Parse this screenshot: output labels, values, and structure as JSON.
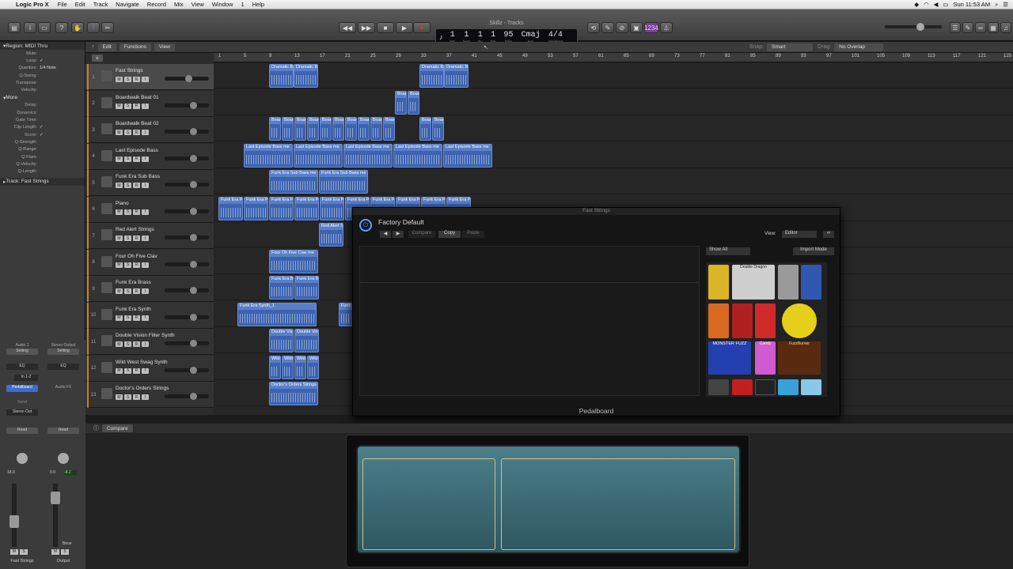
{
  "menubar": {
    "app": "Logic Pro X",
    "items": [
      "File",
      "Edit",
      "Track",
      "Navigate",
      "Record",
      "Mix",
      "View",
      "Window",
      "1",
      "Help"
    ],
    "clock": "Sun 11:53 AM"
  },
  "window_title": "Skillz - Tracks",
  "lcd": {
    "bar": "1",
    "beat": "1",
    "div": "1",
    "tick": "1",
    "tempo": "95",
    "key": "Cmaj",
    "sig": "4/4",
    "labels": [
      "bar",
      "beat",
      "div",
      "tick",
      "bpm",
      "key",
      "signature"
    ]
  },
  "count_in": "1234",
  "toolbar_right": {
    "snap_label": "Snap:",
    "snap_value": "Smart",
    "drag_label": "Drag:",
    "drag_value": "No Overlap"
  },
  "tracks_header": {
    "edit": "Edit",
    "functions": "Functions",
    "view": "View"
  },
  "inspector": {
    "region_title": "Region: MIDI Thru",
    "rows": [
      {
        "k": "Mute:",
        "v": ""
      },
      {
        "k": "Loop:",
        "v": "✓"
      },
      {
        "k": "Quantize:",
        "v": "1/4 Note"
      },
      {
        "k": "Q-Swing:",
        "v": ""
      },
      {
        "k": "Transpose:",
        "v": ""
      },
      {
        "k": "Velocity:",
        "v": ""
      }
    ],
    "more_title": "More",
    "more_rows": [
      {
        "k": "Delay:",
        "v": ""
      },
      {
        "k": "Dynamics:",
        "v": ""
      },
      {
        "k": "Gate Time:",
        "v": ""
      },
      {
        "k": "Clip Length:",
        "v": "✓"
      },
      {
        "k": "Score:",
        "v": "✓"
      },
      {
        "k": "Q-Strength:",
        "v": ""
      },
      {
        "k": "Q-Range:",
        "v": ""
      },
      {
        "k": "Q-Flam:",
        "v": ""
      },
      {
        "k": "Q-Velocity:",
        "v": ""
      },
      {
        "k": "Q-Length:",
        "v": ""
      }
    ],
    "track_title": "Track:  Fast Strings"
  },
  "mixer": {
    "left": {
      "input": "Audio 1",
      "setting": "Setting",
      "eq": "EQ",
      "in": "In 1-2",
      "fx": "Pedalboard",
      "send": "Send",
      "out": "Stereo Out",
      "auto": "Read",
      "vol": "18.0",
      "name": "Fast Strings",
      "ms": [
        "M",
        "S"
      ]
    },
    "right": {
      "input": "Stereo Output",
      "setting": "Setting",
      "eq": "EQ",
      "fx": "Audio FX",
      "auto": "Read",
      "vol": "0.0",
      "peak": "-8.2",
      "name": "Output",
      "bnc": "Bnce",
      "ms": [
        "M",
        "S"
      ]
    }
  },
  "ruler": [
    {
      "n": "1"
    },
    {
      "n": "5"
    },
    {
      "n": "9"
    },
    {
      "n": "13"
    },
    {
      "n": "17"
    },
    {
      "n": "21"
    },
    {
      "n": "25"
    },
    {
      "n": "29"
    },
    {
      "n": "33"
    },
    {
      "n": "37"
    },
    {
      "n": "41"
    },
    {
      "n": "45"
    },
    {
      "n": "49"
    },
    {
      "n": "53"
    },
    {
      "n": "57"
    },
    {
      "n": "61"
    },
    {
      "n": "65"
    },
    {
      "n": "69"
    },
    {
      "n": "73"
    },
    {
      "n": "77"
    },
    {
      "n": "81"
    },
    {
      "n": "85"
    },
    {
      "n": "89"
    },
    {
      "n": "93"
    },
    {
      "n": "97"
    },
    {
      "n": "101"
    },
    {
      "n": "105"
    },
    {
      "n": "109"
    },
    {
      "n": "113"
    },
    {
      "n": "117"
    },
    {
      "n": "121"
    },
    {
      "n": "125"
    }
  ],
  "tracks": [
    {
      "num": "1",
      "name": "Fast Strings",
      "sel": true
    },
    {
      "num": "2",
      "name": "Boardwalk Beat 01"
    },
    {
      "num": "3",
      "name": "Boardwalk Beat 02"
    },
    {
      "num": "4",
      "name": "Last Episode Bass"
    },
    {
      "num": "5",
      "name": "Funk Era Sub Bass"
    },
    {
      "num": "6",
      "name": "Piano"
    },
    {
      "num": "7",
      "name": "Red Alert Strings"
    },
    {
      "num": "8",
      "name": "Four Oh Five Clav"
    },
    {
      "num": "9",
      "name": "Funk Era Brass"
    },
    {
      "num": "10",
      "name": "Funk Era Synth"
    },
    {
      "num": "11",
      "name": "Double Vision Filter Synth"
    },
    {
      "num": "12",
      "name": "Wild West Swag Synth"
    },
    {
      "num": "13",
      "name": "Doctor's Orders Strings"
    }
  ],
  "track_buttons": [
    "M",
    "S",
    "R",
    "I"
  ],
  "regions": [
    {
      "lane": 0,
      "t": "Dramatic B"
    },
    {
      "lane": 0,
      "t": "Dramatic B"
    },
    {
      "lane": 0,
      "t": "Dramatic B"
    },
    {
      "lane": 0,
      "t": "Dramatic B"
    },
    {
      "lane": 1,
      "t": "Boar"
    },
    {
      "lane": 1,
      "t": "Boar"
    },
    {
      "lane": 2,
      "t": "Boar"
    },
    {
      "lane": 2,
      "t": "Boar"
    },
    {
      "lane": 2,
      "t": "Boar"
    },
    {
      "lane": 2,
      "t": "Boar"
    },
    {
      "lane": 2,
      "t": "Boar"
    },
    {
      "lane": 2,
      "t": "Boar"
    },
    {
      "lane": 2,
      "t": "Boar"
    },
    {
      "lane": 2,
      "t": "Boar"
    },
    {
      "lane": 2,
      "t": "Boar"
    },
    {
      "lane": 2,
      "t": "Boar"
    },
    {
      "lane": 2,
      "t": "Boar"
    },
    {
      "lane": 2,
      "t": "Boar"
    },
    {
      "lane": 3,
      "t": "Last Episode Bass me"
    },
    {
      "lane": 3,
      "t": "Last Episode Bass me"
    },
    {
      "lane": 3,
      "t": "Last Episode Bass me"
    },
    {
      "lane": 3,
      "t": "Last Episode Bass me"
    },
    {
      "lane": 3,
      "t": "Last Episode Bass me"
    },
    {
      "lane": 4,
      "t": "Funk Era Sub Bass me"
    },
    {
      "lane": 4,
      "t": "Funk Era Sub Bass me"
    },
    {
      "lane": 5,
      "t": "Funk Era P"
    },
    {
      "lane": 5,
      "t": "Funk Era P"
    },
    {
      "lane": 5,
      "t": "Funk Era P"
    },
    {
      "lane": 5,
      "t": "Funk Era P"
    },
    {
      "lane": 5,
      "t": "Funk Era P"
    },
    {
      "lane": 5,
      "t": "Funk Era P"
    },
    {
      "lane": 5,
      "t": "Funk Era P"
    },
    {
      "lane": 5,
      "t": "Funk Era P"
    },
    {
      "lane": 5,
      "t": "Funk Era P"
    },
    {
      "lane": 5,
      "t": "Funk Era P"
    },
    {
      "lane": 6,
      "t": "Red Alert S"
    },
    {
      "lane": 7,
      "t": "Four Oh Five Clav me"
    },
    {
      "lane": 8,
      "t": "Funk Era B"
    },
    {
      "lane": 8,
      "t": "Funk Era B"
    },
    {
      "lane": 9,
      "t": "Funk Era Synth_1"
    },
    {
      "lane": 9,
      "t": "Funk"
    },
    {
      "lane": 10,
      "t": "Double Vis"
    },
    {
      "lane": 10,
      "t": "Double Vis"
    },
    {
      "lane": 11,
      "t": "Wild"
    },
    {
      "lane": 11,
      "t": "Wild"
    },
    {
      "lane": 11,
      "t": "Wild"
    },
    {
      "lane": 11,
      "t": "Wild"
    },
    {
      "lane": 12,
      "t": "Doctor's Orders Strings"
    }
  ],
  "plugin": {
    "title": "Fast Strings",
    "preset": "Factory Default",
    "compare": "Compare",
    "copy": "Copy",
    "paste": "Paste",
    "view_label": "View:",
    "view_value": "Editor",
    "show_all": "Show All",
    "import_mode": "Import Mode",
    "footer": "Pedalboard"
  },
  "pedal_labels": [
    "Double Dragon",
    "MONSTER FUZZ",
    "Candy",
    "FuzzBurner"
  ],
  "bottom": {
    "compare": "Compare"
  },
  "colors": {
    "region": "#3d63b0",
    "region_header": "#5a7fc8",
    "accent": "#d07a20",
    "board": "#4b7f8a"
  }
}
